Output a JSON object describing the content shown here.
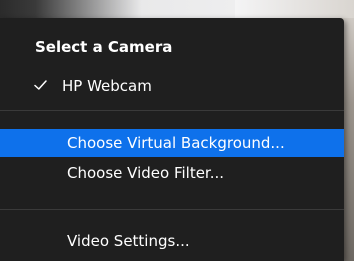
{
  "menu": {
    "header": "Select a Camera",
    "camera_items": [
      {
        "label": "HP Webcam",
        "checked": true
      }
    ],
    "items": [
      {
        "label": "Choose Virtual Background...",
        "highlighted": true
      },
      {
        "label": "Choose Video Filter...",
        "highlighted": false
      }
    ],
    "settings_label": "Video Settings..."
  },
  "colors": {
    "menu_bg": "#1f1f1f",
    "highlight": "#0e71eb",
    "text": "#ffffff",
    "divider": "#3a3a3a"
  }
}
